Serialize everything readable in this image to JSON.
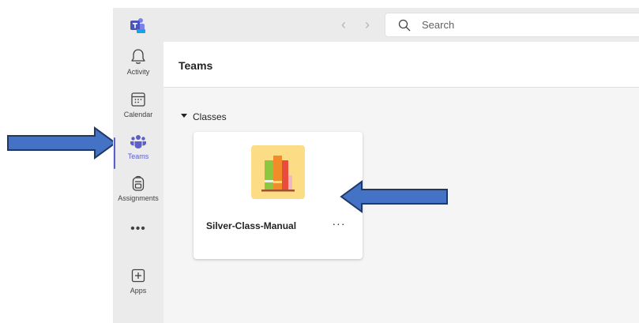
{
  "search": {
    "placeholder": "Search"
  },
  "rail": {
    "items": [
      {
        "label": "Activity",
        "icon": "bell-icon"
      },
      {
        "label": "Calendar",
        "icon": "calendar-icon"
      },
      {
        "label": "Teams",
        "icon": "teams-icon",
        "active": true
      },
      {
        "label": "Assignments",
        "icon": "backpack-icon"
      },
      {
        "label": "Apps",
        "icon": "add-app-icon"
      }
    ],
    "more_label": "•••"
  },
  "main": {
    "title": "Teams",
    "section": "Classes",
    "team": {
      "name": "Silver-Class-Manual",
      "more_label": "···"
    }
  },
  "colors": {
    "accent": "#5b5fc7",
    "annotation_arrow": "#4472c4",
    "avatar_background": "#fddc86"
  }
}
